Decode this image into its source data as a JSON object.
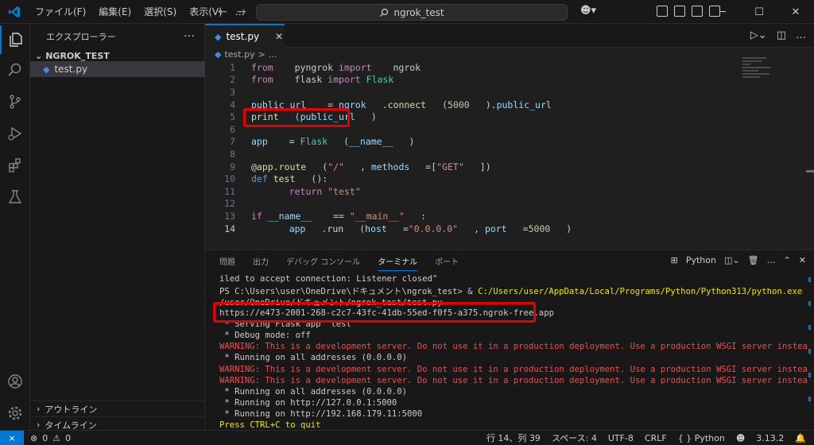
{
  "titlebar": {
    "menu": [
      "ファイル(F)",
      "編集(E)",
      "選択(S)",
      "表示(V)",
      "…"
    ],
    "search": "ngrok_test"
  },
  "sidebar": {
    "title": "エクスプローラー",
    "more": "…",
    "folder": "NGROK_TEST",
    "file": "test.py",
    "outline": "アウトライン",
    "timeline": "タイムライン"
  },
  "editor": {
    "tab": "test.py",
    "breadcrumb": [
      "test.py",
      ">",
      "..."
    ],
    "code": [
      {
        "n": "1",
        "parts": [
          [
            "kw",
            "from"
          ],
          [
            "txt",
            " pyngrok "
          ],
          [
            "kw",
            "import"
          ],
          [
            "txt",
            " ngrok"
          ]
        ]
      },
      {
        "n": "2",
        "parts": [
          [
            "kw",
            "from"
          ],
          [
            "txt",
            " flask "
          ],
          [
            "kw",
            "import"
          ],
          [
            "cls",
            " Flask"
          ]
        ]
      },
      {
        "n": "3",
        "parts": []
      },
      {
        "n": "4",
        "parts": [
          [
            "var",
            "public_url"
          ],
          [
            "txt",
            " = "
          ],
          [
            "var",
            "ngrok"
          ],
          [
            "txt",
            "."
          ],
          [
            "fn",
            "connect"
          ],
          [
            "txt",
            "("
          ],
          [
            "num",
            "5000"
          ],
          [
            "txt",
            ")."
          ],
          [
            "var",
            "public_url"
          ]
        ]
      },
      {
        "n": "5",
        "parts": [
          [
            "fn",
            "print"
          ],
          [
            "txt",
            "("
          ],
          [
            "var",
            "public_url"
          ],
          [
            "txt",
            ")"
          ]
        ]
      },
      {
        "n": "6",
        "parts": []
      },
      {
        "n": "7",
        "parts": [
          [
            "var",
            "app"
          ],
          [
            "txt",
            " = "
          ],
          [
            "cls",
            "Flask"
          ],
          [
            "txt",
            "("
          ],
          [
            "var",
            "__name__"
          ],
          [
            "txt",
            ")"
          ]
        ]
      },
      {
        "n": "8",
        "parts": []
      },
      {
        "n": "9",
        "parts": [
          [
            "fn",
            "@app.route"
          ],
          [
            "txt",
            "("
          ],
          [
            "str",
            "\"/\""
          ],
          [
            "txt",
            ", "
          ],
          [
            "var",
            "methods"
          ],
          [
            "txt",
            "=["
          ],
          [
            "str",
            "\"GET\""
          ],
          [
            "txt",
            "])"
          ]
        ]
      },
      {
        "n": "10",
        "parts": [
          [
            "kw2",
            "def"
          ],
          [
            "fn",
            " test"
          ],
          [
            "txt",
            "():"
          ]
        ]
      },
      {
        "n": "11",
        "parts": [
          [
            "txt",
            "    "
          ],
          [
            "kw",
            "return"
          ],
          [
            "str",
            " \"test\""
          ]
        ]
      },
      {
        "n": "12",
        "parts": []
      },
      {
        "n": "13",
        "parts": [
          [
            "kw",
            "if"
          ],
          [
            "var",
            " __name__"
          ],
          [
            "txt",
            " == "
          ],
          [
            "str",
            "\"__main__\""
          ],
          [
            "txt",
            ":"
          ]
        ]
      },
      {
        "n": "14",
        "parts": [
          [
            "txt",
            "    "
          ],
          [
            "var",
            "app"
          ],
          [
            "txt",
            "."
          ],
          [
            "fn",
            "run"
          ],
          [
            "txt",
            "("
          ],
          [
            "var",
            "host"
          ],
          [
            "txt",
            "="
          ],
          [
            "str",
            "\"0.0.0.0\""
          ],
          [
            "txt",
            ", "
          ],
          [
            "var",
            "port"
          ],
          [
            "txt",
            "="
          ],
          [
            "num",
            "5000"
          ],
          [
            "txt",
            ")"
          ]
        ]
      }
    ]
  },
  "panel": {
    "tabs": [
      "問題",
      "出力",
      "デバッグ コンソール",
      "ターミナル",
      "ポート"
    ],
    "active_tab": "ターミナル",
    "shell": "Python",
    "terminal": [
      {
        "t": "iled to accept connection: Listener closed\"",
        "c": ""
      },
      {
        "t": "PS C:\\Users\\user\\OneDrive\\ドキュメント\\ngrok_test> & C:/Users/user/AppData/Local/Programs/Python/Python313/python.exe c:/Users",
        "c": "ps"
      },
      {
        "t": "/user/OneDrive/ドキュメント/ngrok_test/test.py",
        "c": ""
      },
      {
        "t": "https://e473-2001-268-c2c7-43fc-41db-55ed-f0f5-a375.ngrok-free.app",
        "c": ""
      },
      {
        "t": " * Serving Flask app 'test'",
        "c": ""
      },
      {
        "t": " * Debug mode: off",
        "c": ""
      },
      {
        "t": "WARNING: This is a development server. Do not use it in a production deployment. Use a production WSGI server instead.",
        "c": "warn"
      },
      {
        "t": " * Running on all addresses (0.0.0.0)",
        "c": ""
      },
      {
        "t": "WARNING: This is a development server. Do not use it in a production deployment. Use a production WSGI server instead.",
        "c": "warn"
      },
      {
        "t": "WARNING: This is a development server. Do not use it in a production deployment. Use a production WSGI server instead.",
        "c": "warn"
      },
      {
        "t": " * Running on all addresses (0.0.0.0)",
        "c": ""
      },
      {
        "t": " * Running on http://127.0.0.1:5000",
        "c": ""
      },
      {
        "t": " * Running on http://192.168.179.11:5000",
        "c": ""
      },
      {
        "t": "Press CTRL+C to quit",
        "c": "yellow"
      }
    ]
  },
  "statusbar": {
    "errors": "0",
    "warnings": "0",
    "position": "行 14、列 39",
    "spaces": "スペース: 4",
    "encoding": "UTF-8",
    "eol": "CRLF",
    "language": "Python",
    "version": "3.13.2"
  },
  "colors": {
    "accent": "#0078d4",
    "highlight": "#e60000"
  }
}
